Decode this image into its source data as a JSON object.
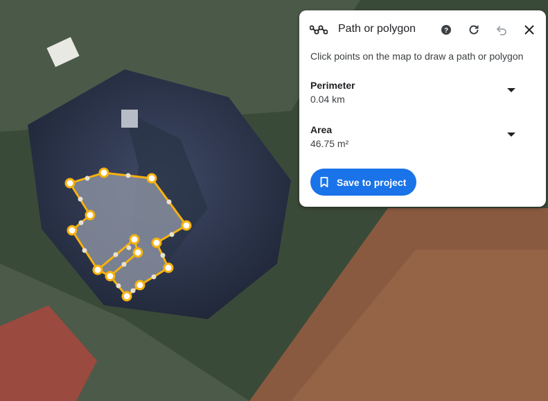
{
  "panel": {
    "title": "Path or polygon",
    "icons": {
      "mode": "ruler-path-icon",
      "help": "help-icon",
      "redo": "refresh-icon",
      "undo": "undo-icon",
      "close": "close-icon"
    },
    "instructions": "Click points on the map to draw a path or polygon",
    "perimeter": {
      "label": "Perimeter",
      "value": "0.04 km"
    },
    "area": {
      "label": "Area",
      "value": "46.75 m²"
    },
    "save_label": "Save to project",
    "save_icon": "bookmark-icon"
  },
  "colors": {
    "accent": "#1a73e8",
    "polygon_stroke": "#f6b20f",
    "polygon_fill": "#8d93a3"
  }
}
